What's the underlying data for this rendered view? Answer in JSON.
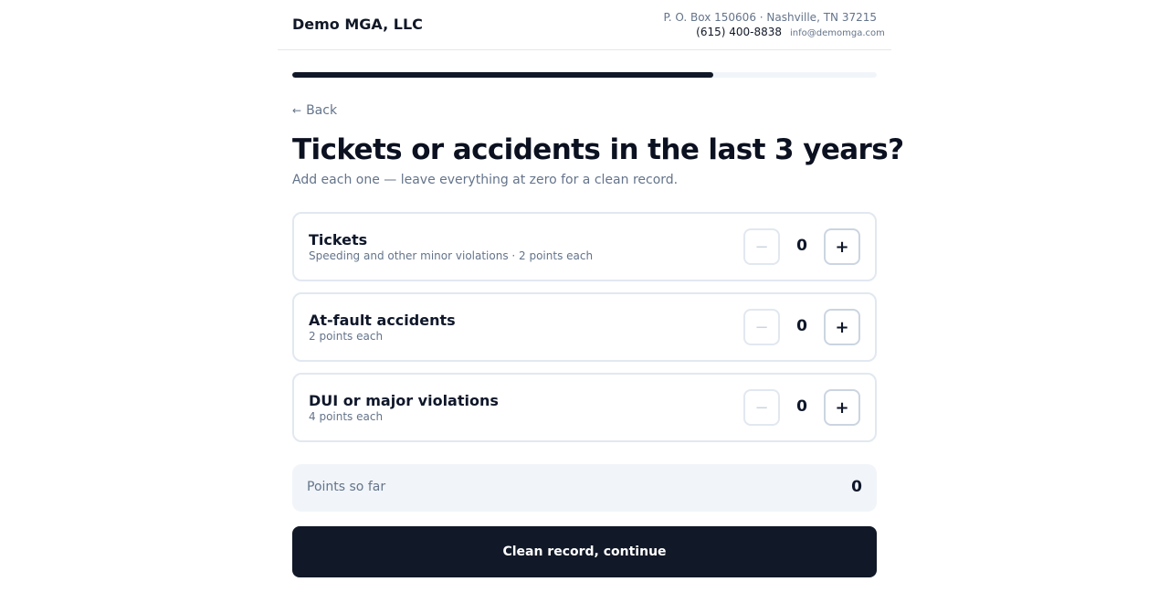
{
  "header": {
    "brand": "Demo MGA, LLC",
    "address": "P. O. Box 150606 · Nashville, TN 37215",
    "phone": "(615) 400-8838",
    "email": "info@demomga.com"
  },
  "progress": {
    "fraction": 0.72
  },
  "back": {
    "arrow": "←",
    "label": "Back"
  },
  "question": {
    "title": "Tickets or accidents in the last 3 years?",
    "subtitle": "Add each one — leave everything at zero for a clean record."
  },
  "counters": [
    {
      "title": "Tickets",
      "description": "Speeding and other minor violations · 2 points each",
      "value": "0",
      "minus": "−",
      "plus": "+"
    },
    {
      "title": "At-fault accidents",
      "description": "2 points each",
      "value": "0",
      "minus": "−",
      "plus": "+"
    },
    {
      "title": "DUI or major violations",
      "description": "4 points each",
      "value": "0",
      "minus": "−",
      "plus": "+"
    }
  ],
  "points": {
    "label": "Points so far",
    "value": "0"
  },
  "continue": {
    "label": "Clean record, continue"
  },
  "colors": {
    "primary": "#111827",
    "muted": "#64748b",
    "border": "#e2e8f0",
    "surface": "#f1f5f9"
  }
}
